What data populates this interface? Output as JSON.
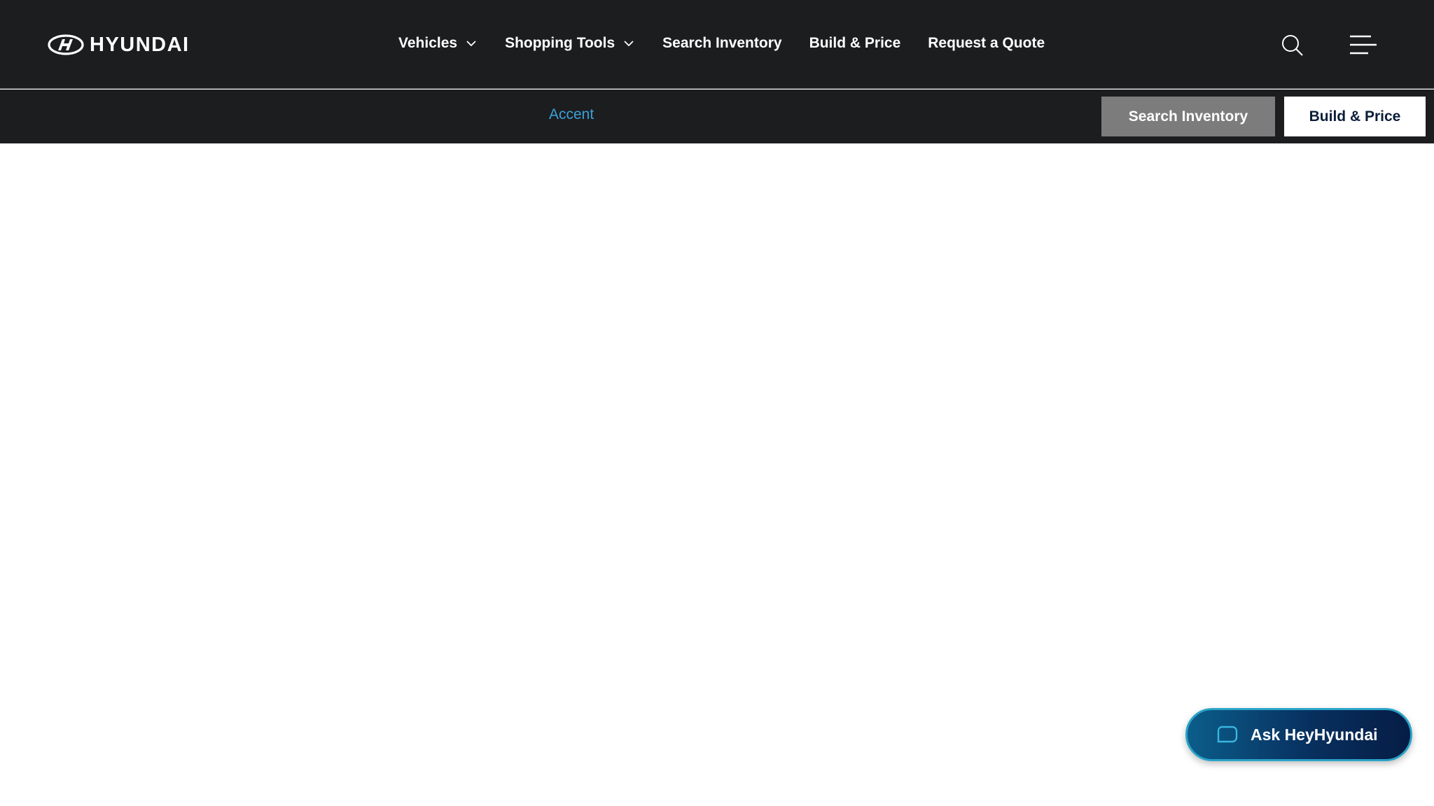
{
  "brand": {
    "name": "HYUNDAI",
    "logo_icon": "hyundai-h-logo-icon"
  },
  "nav": {
    "items": [
      {
        "label": "Vehicles",
        "has_dropdown": true
      },
      {
        "label": "Shopping Tools",
        "has_dropdown": true
      },
      {
        "label": "Search Inventory",
        "has_dropdown": false
      },
      {
        "label": "Build & Price",
        "has_dropdown": false
      },
      {
        "label": "Request a Quote",
        "has_dropdown": false
      }
    ],
    "icons": {
      "search": "search-icon",
      "menu": "hamburger-menu-icon",
      "dropdown": "chevron-down-icon"
    }
  },
  "subnav": {
    "model": "Accent",
    "search_inventory_label": "Search Inventory",
    "build_price_label": "Build & Price"
  },
  "assistant": {
    "label": "Ask HeyHyundai",
    "icon": "chat-bubble-icon"
  },
  "colors": {
    "header_bg": "#1c1d1f",
    "model_link": "#3aa0d8",
    "inventory_button_bg": "#7c7c7c",
    "build_button_bg": "#ffffff",
    "build_button_text": "#0b1d3a",
    "assistant_gradient_start": "#0b5d8a",
    "assistant_gradient_end": "#061d45",
    "assistant_border": "#2aa3c8"
  }
}
